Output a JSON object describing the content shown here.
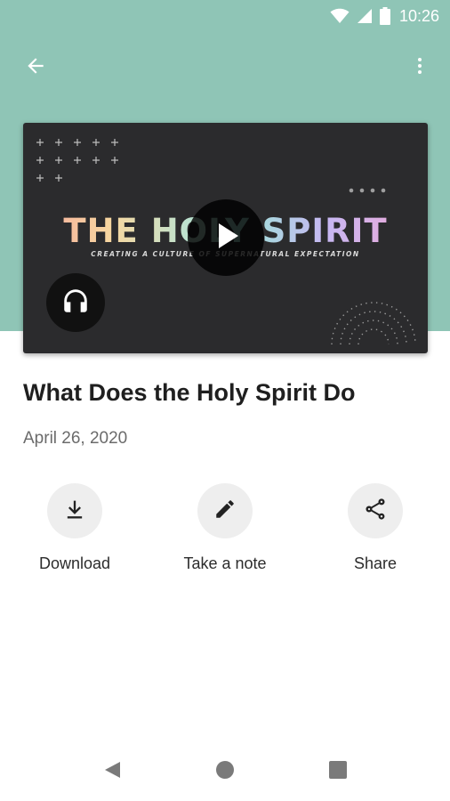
{
  "status_bar": {
    "time": "10:26",
    "icons": [
      "wifi-icon",
      "cellular-signal-icon",
      "battery-icon"
    ]
  },
  "app_bar": {
    "icons": [
      "arrow-back-icon",
      "more-vertical-icon"
    ]
  },
  "media": {
    "artwork_title": "THE HOLY SPIRIT",
    "artwork_subtitle": "CREATING A CULTURE OF SUPERNATURAL EXPECTATION",
    "icons": [
      "play-icon",
      "headphones-icon"
    ]
  },
  "episode": {
    "title": "What Does the Holy Spirit Do",
    "date": "April 26, 2020"
  },
  "actions": [
    {
      "label": "Download",
      "icon": "download-icon"
    },
    {
      "label": "Take a note",
      "icon": "pencil-icon"
    },
    {
      "label": "Share",
      "icon": "share-icon"
    }
  ],
  "nav_bar": {
    "icons": [
      "nav-back-icon",
      "nav-home-icon",
      "nav-recents-icon"
    ]
  },
  "colors": {
    "header": "#8fc5b6",
    "card": "#2b2b2d",
    "action_circle": "#eeeeee",
    "title": "#1f1f1f",
    "date": "#6b6b6b"
  }
}
